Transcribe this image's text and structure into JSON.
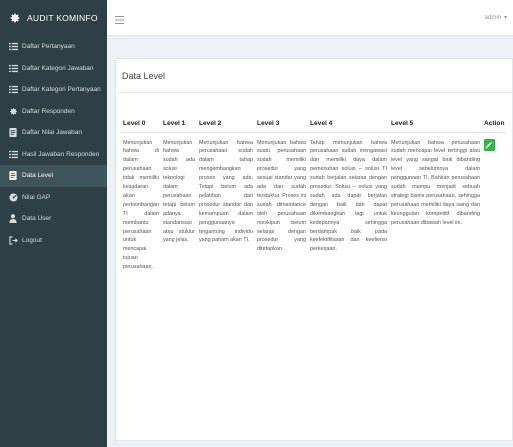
{
  "brand": {
    "title": "AUDIT KOMINFO",
    "icon": "gear-icon"
  },
  "sidebar": {
    "items": [
      {
        "label": "Daftar Pertanyaan",
        "icon": "list-icon",
        "active": false
      },
      {
        "label": "Daftar Kategori Jawaban",
        "icon": "list-icon",
        "active": false
      },
      {
        "label": "Daftar Kategori Pertanyaan",
        "icon": "list-icon",
        "active": false
      },
      {
        "label": "Daftar Responden",
        "icon": "gear-icon",
        "active": false
      },
      {
        "label": "Daftar Nilai Jawaban",
        "icon": "document-icon",
        "active": false
      },
      {
        "label": "Hasil Jawaban Responden",
        "icon": "list-icon",
        "active": false
      },
      {
        "label": "Data Level",
        "icon": "document-icon",
        "active": true
      },
      {
        "label": "Nilai GAP",
        "icon": "dashboard-icon",
        "active": false
      },
      {
        "label": "Data User",
        "icon": "user-icon",
        "active": false
      },
      {
        "label": "Logout",
        "icon": "logout-icon",
        "active": false
      }
    ]
  },
  "topbar": {
    "user": "admin",
    "user_caret": "▾"
  },
  "main": {
    "title": "Data Level",
    "table": {
      "headers": [
        "Level 0",
        "Level 1",
        "Level 2",
        "Level 3",
        "Level 4",
        "Level 5",
        "Action"
      ],
      "row": [
        "Menunjukan bahwa di dalam perusahaan tidak memiliki kesadaran akan perkembangan TI dalam membantu perusahaan untuk mencapai tujuan perusahaan.",
        "Menunjukan bahwa sudah ada solusi teknologi dalam perusahaan tetapi belum adanya standarisasi atau stuktur yang jelas.",
        "Menunjukan bahwa perusahaan sudah dalam tahap mengembangkan proses yang ada. Tetapi belum ada pelatihan dari prosedur standar dan kemampuan dalam penggunaanya tergantung individu yang paham akan TI.",
        "Menunjukan bahwa suatu perusahaan sudah memiliki prosedur yang sesuai standar yang ada dan sudah terstuktur. Proses ini sudah dimaintance oleh perusahaan meskipun belum selaras dengan prosedur yang ditetapkan.",
        "Tahap menunjukan bahwa perusahaan sudah mengawasi dan memiliki daya dalam pemenuhan solusi – solusi TI sudah berjalan selaras dengan prosedur. Solusi – solusi yang sudah ada dapat berjalan dengan baik dan dapat dikembangkan lagi untuk kedepannya sehingga berdampak baik pada keefektifitasan dan keefiensi perkerjaan.",
        "Menunjukan bahwa perusahaan sudah mencapai level tertinggi atau level yang sangat baik dibanding level sebelumnya dalam penggunaan TI. Bahkan perusahaan sudah mampu menjadi sebuah strategi bisnis perusahaan, sehingga perusahaan memiliki daya saing dan keunggulan kompetitif dibanding perusahaan dibawah level ini."
      ]
    }
  },
  "colors": {
    "sidebar": "#2e3f45",
    "sidebar_active": "#3f535a",
    "action_button": "#2db742"
  }
}
